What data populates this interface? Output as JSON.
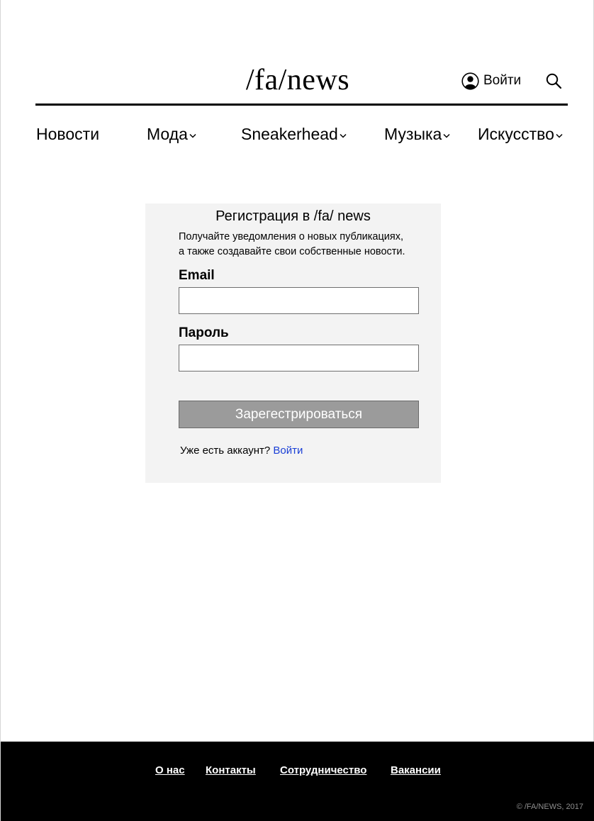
{
  "header": {
    "logo": "/fa/news",
    "login_label": "Войти",
    "icons": {
      "user": "user-circle-icon",
      "search": "search-icon"
    }
  },
  "nav": {
    "items": [
      {
        "label": "Новости",
        "has_dropdown": false
      },
      {
        "label": "Мода",
        "has_dropdown": true
      },
      {
        "label": "Sneakerhead",
        "has_dropdown": true
      },
      {
        "label": "Музыка",
        "has_dropdown": true
      },
      {
        "label": "Искусство",
        "has_dropdown": true
      }
    ]
  },
  "register": {
    "title": "Регистрация в /fa/ news",
    "subtitle_line1": "Получайте уведомления о новых публикациях,",
    "subtitle_line2": "а также создавайте свои собственные новости.",
    "email_label": "Email",
    "email_value": "",
    "password_label": "Пароль",
    "password_value": "",
    "submit_label": "Зарегестрироваться",
    "have_account_text": "Уже есть аккаунт?",
    "login_link": "Войти"
  },
  "footer": {
    "links": [
      "О нас",
      "Контакты",
      "Сотрудничество",
      "Вакансии"
    ],
    "copyright": "© /FA/NEWS, 2017"
  },
  "colors": {
    "accent_link": "#1a3fd6",
    "button_bg": "#9b9b9b",
    "card_bg": "#f3f3f3",
    "footer_bg": "#000000"
  }
}
